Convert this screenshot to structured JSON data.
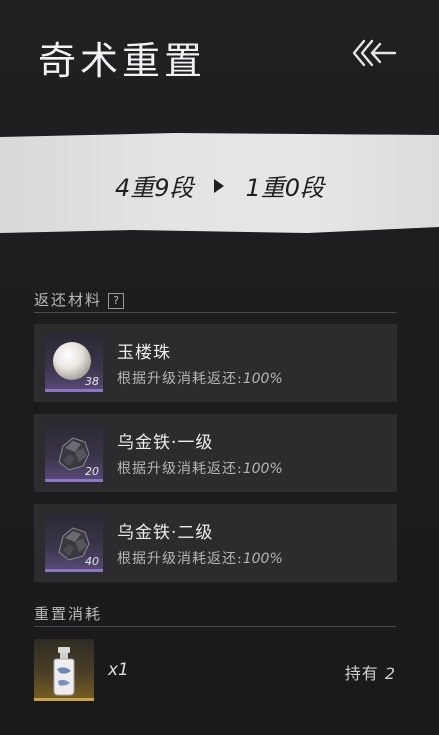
{
  "header": {
    "title": "奇术重置"
  },
  "banner": {
    "from": "4重9段",
    "to": "1重0段"
  },
  "returns": {
    "label": "返还材料",
    "help": "?",
    "items": [
      {
        "name": "玉楼珠",
        "count": "38",
        "desc": "根据升级消耗返还:",
        "pct": "100%",
        "icon": "pearl-icon"
      },
      {
        "name": "乌金铁·一级",
        "count": "20",
        "desc": "根据升级消耗返还:",
        "pct": "100%",
        "icon": "ore-icon"
      },
      {
        "name": "乌金铁·二级",
        "count": "40",
        "desc": "根据升级消耗返还:",
        "pct": "100%",
        "icon": "ore-icon"
      }
    ]
  },
  "cost": {
    "label": "重置消耗",
    "qty": "x1",
    "hold_label": "持有",
    "hold_value": "2",
    "icon": "bottle-icon"
  }
}
